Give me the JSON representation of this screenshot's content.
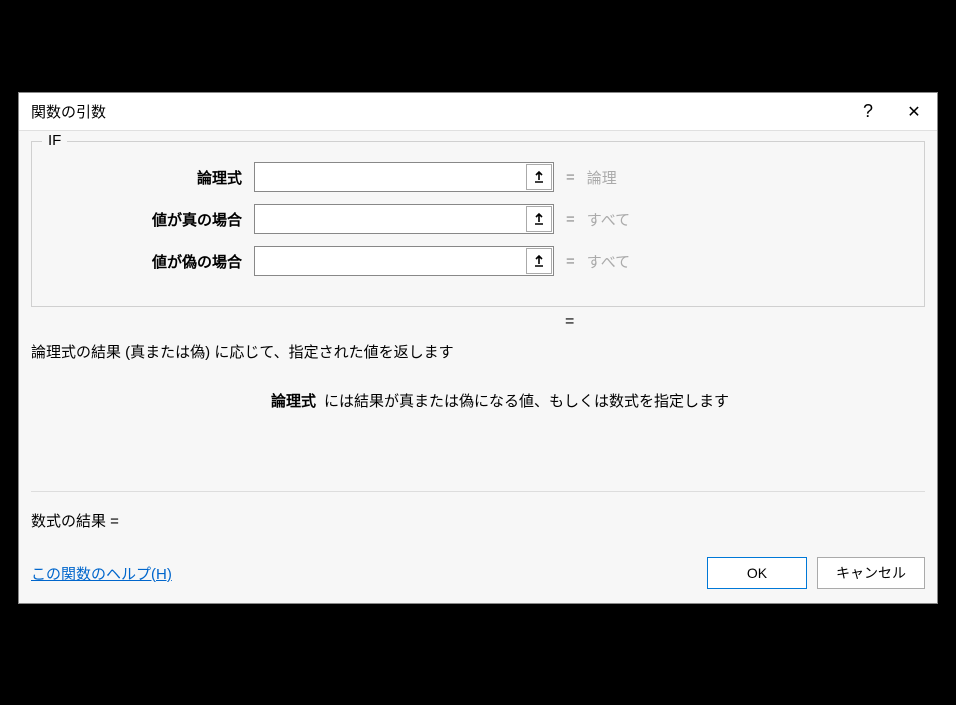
{
  "dialog": {
    "title": "関数の引数",
    "helpSymbol": "?",
    "closeSymbol": "✕"
  },
  "function": {
    "name": "IF",
    "args": [
      {
        "label": "論理式",
        "value": "",
        "hint": "論理"
      },
      {
        "label": "値が真の場合",
        "value": "",
        "hint": "すべて"
      },
      {
        "label": "値が偽の場合",
        "value": "",
        "hint": "すべて"
      }
    ],
    "resultEq": "=",
    "description": "論理式の結果 (真または偽) に応じて、指定された値を返します",
    "paramHelp": {
      "name": "論理式",
      "text": "には結果が真または偽になる値、もしくは数式を指定します"
    }
  },
  "formulaResult": {
    "label": "数式の結果 =",
    "value": ""
  },
  "helpLink": "この関数のヘルプ(H)",
  "buttons": {
    "ok": "OK",
    "cancel": "キャンセル"
  }
}
